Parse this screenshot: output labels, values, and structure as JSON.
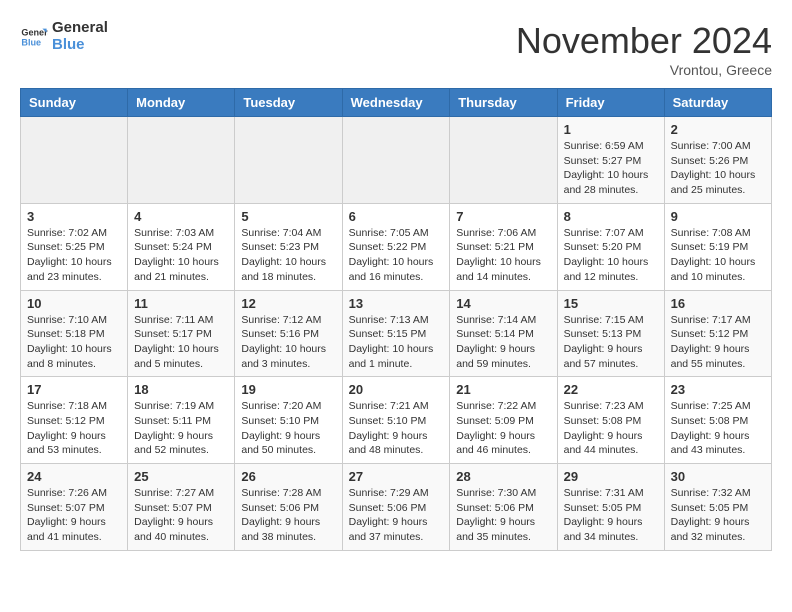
{
  "header": {
    "logo_line1": "General",
    "logo_line2": "Blue",
    "month": "November 2024",
    "location": "Vrontou, Greece"
  },
  "days_of_week": [
    "Sunday",
    "Monday",
    "Tuesday",
    "Wednesday",
    "Thursday",
    "Friday",
    "Saturday"
  ],
  "weeks": [
    [
      {
        "day": "",
        "info": ""
      },
      {
        "day": "",
        "info": ""
      },
      {
        "day": "",
        "info": ""
      },
      {
        "day": "",
        "info": ""
      },
      {
        "day": "",
        "info": ""
      },
      {
        "day": "1",
        "info": "Sunrise: 6:59 AM\nSunset: 5:27 PM\nDaylight: 10 hours and 28 minutes."
      },
      {
        "day": "2",
        "info": "Sunrise: 7:00 AM\nSunset: 5:26 PM\nDaylight: 10 hours and 25 minutes."
      }
    ],
    [
      {
        "day": "3",
        "info": "Sunrise: 7:02 AM\nSunset: 5:25 PM\nDaylight: 10 hours and 23 minutes."
      },
      {
        "day": "4",
        "info": "Sunrise: 7:03 AM\nSunset: 5:24 PM\nDaylight: 10 hours and 21 minutes."
      },
      {
        "day": "5",
        "info": "Sunrise: 7:04 AM\nSunset: 5:23 PM\nDaylight: 10 hours and 18 minutes."
      },
      {
        "day": "6",
        "info": "Sunrise: 7:05 AM\nSunset: 5:22 PM\nDaylight: 10 hours and 16 minutes."
      },
      {
        "day": "7",
        "info": "Sunrise: 7:06 AM\nSunset: 5:21 PM\nDaylight: 10 hours and 14 minutes."
      },
      {
        "day": "8",
        "info": "Sunrise: 7:07 AM\nSunset: 5:20 PM\nDaylight: 10 hours and 12 minutes."
      },
      {
        "day": "9",
        "info": "Sunrise: 7:08 AM\nSunset: 5:19 PM\nDaylight: 10 hours and 10 minutes."
      }
    ],
    [
      {
        "day": "10",
        "info": "Sunrise: 7:10 AM\nSunset: 5:18 PM\nDaylight: 10 hours and 8 minutes."
      },
      {
        "day": "11",
        "info": "Sunrise: 7:11 AM\nSunset: 5:17 PM\nDaylight: 10 hours and 5 minutes."
      },
      {
        "day": "12",
        "info": "Sunrise: 7:12 AM\nSunset: 5:16 PM\nDaylight: 10 hours and 3 minutes."
      },
      {
        "day": "13",
        "info": "Sunrise: 7:13 AM\nSunset: 5:15 PM\nDaylight: 10 hours and 1 minute."
      },
      {
        "day": "14",
        "info": "Sunrise: 7:14 AM\nSunset: 5:14 PM\nDaylight: 9 hours and 59 minutes."
      },
      {
        "day": "15",
        "info": "Sunrise: 7:15 AM\nSunset: 5:13 PM\nDaylight: 9 hours and 57 minutes."
      },
      {
        "day": "16",
        "info": "Sunrise: 7:17 AM\nSunset: 5:12 PM\nDaylight: 9 hours and 55 minutes."
      }
    ],
    [
      {
        "day": "17",
        "info": "Sunrise: 7:18 AM\nSunset: 5:12 PM\nDaylight: 9 hours and 53 minutes."
      },
      {
        "day": "18",
        "info": "Sunrise: 7:19 AM\nSunset: 5:11 PM\nDaylight: 9 hours and 52 minutes."
      },
      {
        "day": "19",
        "info": "Sunrise: 7:20 AM\nSunset: 5:10 PM\nDaylight: 9 hours and 50 minutes."
      },
      {
        "day": "20",
        "info": "Sunrise: 7:21 AM\nSunset: 5:10 PM\nDaylight: 9 hours and 48 minutes."
      },
      {
        "day": "21",
        "info": "Sunrise: 7:22 AM\nSunset: 5:09 PM\nDaylight: 9 hours and 46 minutes."
      },
      {
        "day": "22",
        "info": "Sunrise: 7:23 AM\nSunset: 5:08 PM\nDaylight: 9 hours and 44 minutes."
      },
      {
        "day": "23",
        "info": "Sunrise: 7:25 AM\nSunset: 5:08 PM\nDaylight: 9 hours and 43 minutes."
      }
    ],
    [
      {
        "day": "24",
        "info": "Sunrise: 7:26 AM\nSunset: 5:07 PM\nDaylight: 9 hours and 41 minutes."
      },
      {
        "day": "25",
        "info": "Sunrise: 7:27 AM\nSunset: 5:07 PM\nDaylight: 9 hours and 40 minutes."
      },
      {
        "day": "26",
        "info": "Sunrise: 7:28 AM\nSunset: 5:06 PM\nDaylight: 9 hours and 38 minutes."
      },
      {
        "day": "27",
        "info": "Sunrise: 7:29 AM\nSunset: 5:06 PM\nDaylight: 9 hours and 37 minutes."
      },
      {
        "day": "28",
        "info": "Sunrise: 7:30 AM\nSunset: 5:06 PM\nDaylight: 9 hours and 35 minutes."
      },
      {
        "day": "29",
        "info": "Sunrise: 7:31 AM\nSunset: 5:05 PM\nDaylight: 9 hours and 34 minutes."
      },
      {
        "day": "30",
        "info": "Sunrise: 7:32 AM\nSunset: 5:05 PM\nDaylight: 9 hours and 32 minutes."
      }
    ]
  ]
}
